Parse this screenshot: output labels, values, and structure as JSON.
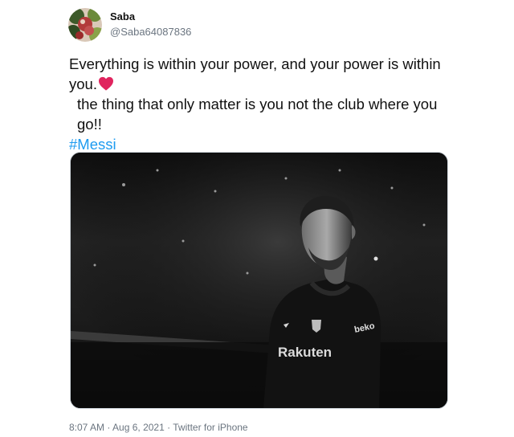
{
  "author": {
    "name": "Saba",
    "handle": "@Saba64087836"
  },
  "tweet": {
    "line1": "Everything is within your power, and your power is within you.",
    "line2": "the thing that only matter is you not the club where you go!!",
    "hashtag": "#Messi",
    "heart_color": "#e0245e",
    "hashtag_color": "#1d9bf0"
  },
  "photo": {
    "jersey_sponsor": "Rakuten",
    "sleeve_logo": "beko"
  },
  "meta": {
    "time": "8:07 AM",
    "separator": " · ",
    "date": "Aug 6, 2021",
    "source": "Twitter for iPhone"
  }
}
